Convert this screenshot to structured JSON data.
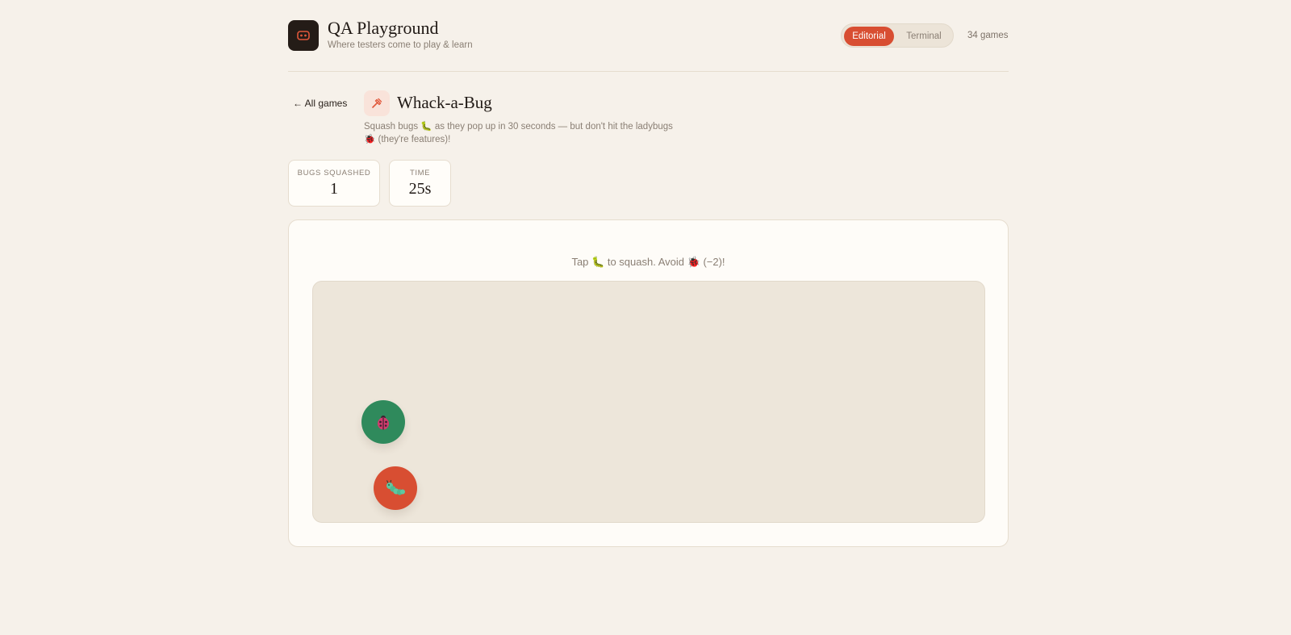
{
  "header": {
    "title": "QA Playground",
    "subtitle": "Where testers come to play & learn",
    "modes": [
      "Editorial",
      "Terminal"
    ],
    "active_mode": "Editorial",
    "games_count": "34 games"
  },
  "game": {
    "back_label": "← All games",
    "icon": "hammer-icon",
    "title": "Whack-a-Bug",
    "description_part1": "Squash bugs",
    "description_part2": "as they pop up in 30 seconds — but don't hit the ladybugs",
    "description_part3": "(they're features)!"
  },
  "stats": {
    "bugs_label": "BUGS SQUASHED",
    "bugs_value": "1",
    "time_label": "TIME",
    "time_value": "25s"
  },
  "board": {
    "instr_part1": "Tap",
    "instr_part2": "to squash. Avoid",
    "instr_part3": "(−2)!",
    "targets": [
      {
        "kind": "ladybug",
        "icon": "ladybug-icon"
      },
      {
        "kind": "bug",
        "icon": "caterpillar-icon"
      }
    ]
  },
  "colors": {
    "accent": "#d84e32",
    "ladybug_tile": "#2f8a5c",
    "background": "#f6f1ea",
    "logo": "#241c17"
  }
}
